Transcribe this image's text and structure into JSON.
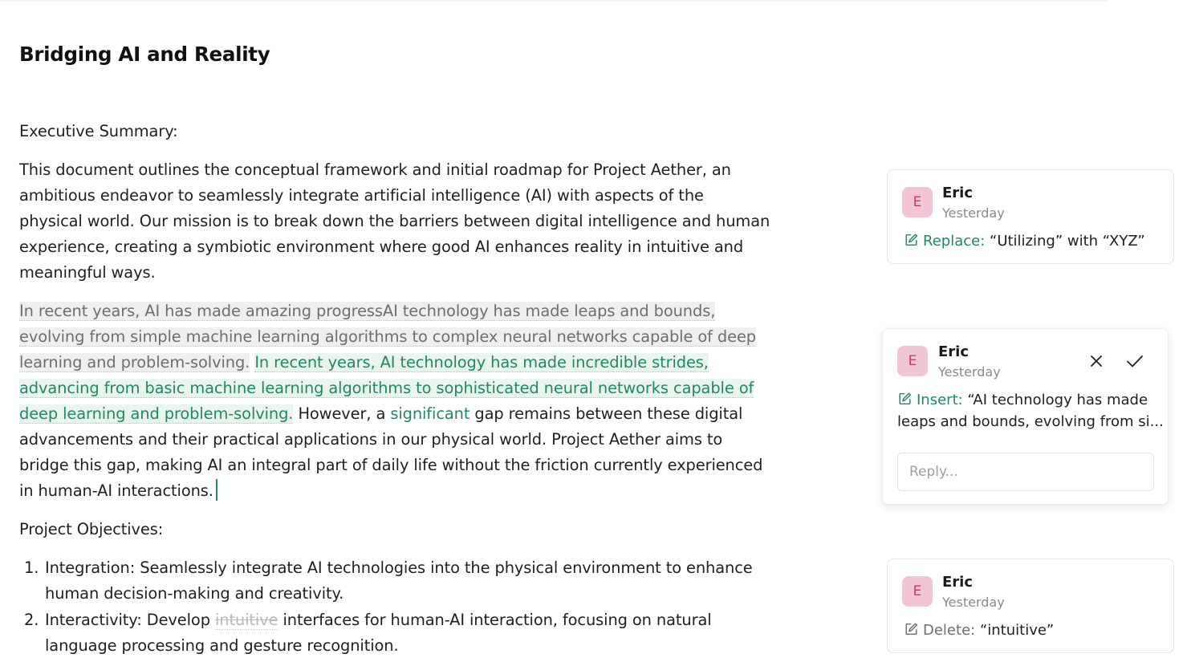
{
  "document": {
    "title": "Bridging AI and Reality",
    "exec_summary_heading": "Executive Summary:",
    "intro_lines": [
      "This document outlines the conceptual framework and initial roadmap for Project Aether, an",
      "ambitious endeavor to seamlessly integrate artificial intelligence (AI) with aspects of the",
      "physical world. Our mission is to break down the barriers between digital intelligence and human",
      "experience, creating a symbiotic environment where good AI enhances reality in intuitive and",
      "meaningful ways."
    ],
    "tracked": {
      "old_line_1": "In recent years, AI has made amazing progressAI technology has made leaps and bounds,",
      "old_line_2": "evolving from simple machine learning algorithms to complex neural networks capable of deep",
      "old_line_3": "learning and problem-solving.",
      "new_line_1": "In recent years, AI technology has made incredible strides,",
      "new_line_2": "advancing from basic machine learning algorithms to sophisticated neural networks capable of",
      "new_line_3": "deep learning and problem-solving.",
      "after_1a": " However, a ",
      "highlight_word": "significant",
      "after_1b": " gap remains between these digital",
      "after_2": "advancements and their practical applications in our physical world. Project Aether aims to",
      "after_3": "bridge this gap, making AI an integral part of daily life without the friction currently experienced",
      "after_4": "in human-AI interactions."
    },
    "objectives_heading": "Project Objectives:",
    "objectives": [
      {
        "num": "1.",
        "line1": "Integration: Seamlessly integrate AI technologies into the physical environment to enhance",
        "line2": "human decision-making and creativity."
      },
      {
        "num": "2.",
        "line1a": "Interactivity: Develop ",
        "deleted": "intuitive",
        "line1b": " interfaces for human-AI interaction, focusing on natural",
        "line2": "language processing and gesture recognition."
      }
    ]
  },
  "comments": [
    {
      "avatar": "E",
      "author": "Eric",
      "time": "Yesterday",
      "kind": "Replace:",
      "text": " “Utilizing” with “XYZ”",
      "icon": "suggest-edit-icon"
    },
    {
      "avatar": "E",
      "author": "Eric",
      "time": "Yesterday",
      "kind": "Insert:",
      "text_line1": " “AI technology has made",
      "text_line2": "leaps and bounds, evolving from si...",
      "icon": "suggest-edit-icon",
      "reject_icon": "close-icon",
      "accept_icon": "check-icon",
      "reply_placeholder": "Reply..."
    },
    {
      "avatar": "E",
      "author": "Eric",
      "time": "Yesterday",
      "kind": "Delete:",
      "text": " “intuitive”",
      "icon": "suggest-edit-icon"
    }
  ],
  "colors": {
    "suggestion_green": "#1f8a5b",
    "avatar_bg": "#f1c5d5",
    "avatar_text": "#c23d6d",
    "deleted_bg": "#efefee"
  }
}
